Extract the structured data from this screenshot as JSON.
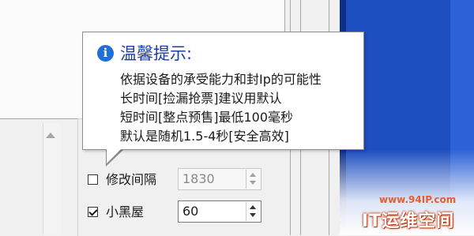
{
  "tooltip": {
    "icon": "info-icon",
    "title": "温馨提示:",
    "lines": [
      "依据设备的承受能力和封Ip的可能性",
      "长时间[捡漏抢票]建议用默认",
      "短时间[整点预售]最低100毫秒",
      "默认是随机1.5-4秒[安全高效]"
    ]
  },
  "form": {
    "modify_interval": {
      "label": "修改间隔",
      "checked": false,
      "value": "1830",
      "enabled": false
    },
    "blackroom": {
      "label": "小黑屋",
      "checked": true,
      "value": "60",
      "enabled": true
    }
  },
  "watermark": {
    "url": "www.94IP.com",
    "brand": "IT运维空间"
  },
  "colors": {
    "tooltip_title": "#1d3da0",
    "info_icon": "#1f6fd6",
    "right_panel": "#1e4fc0",
    "watermark_accent": "#e06030"
  }
}
